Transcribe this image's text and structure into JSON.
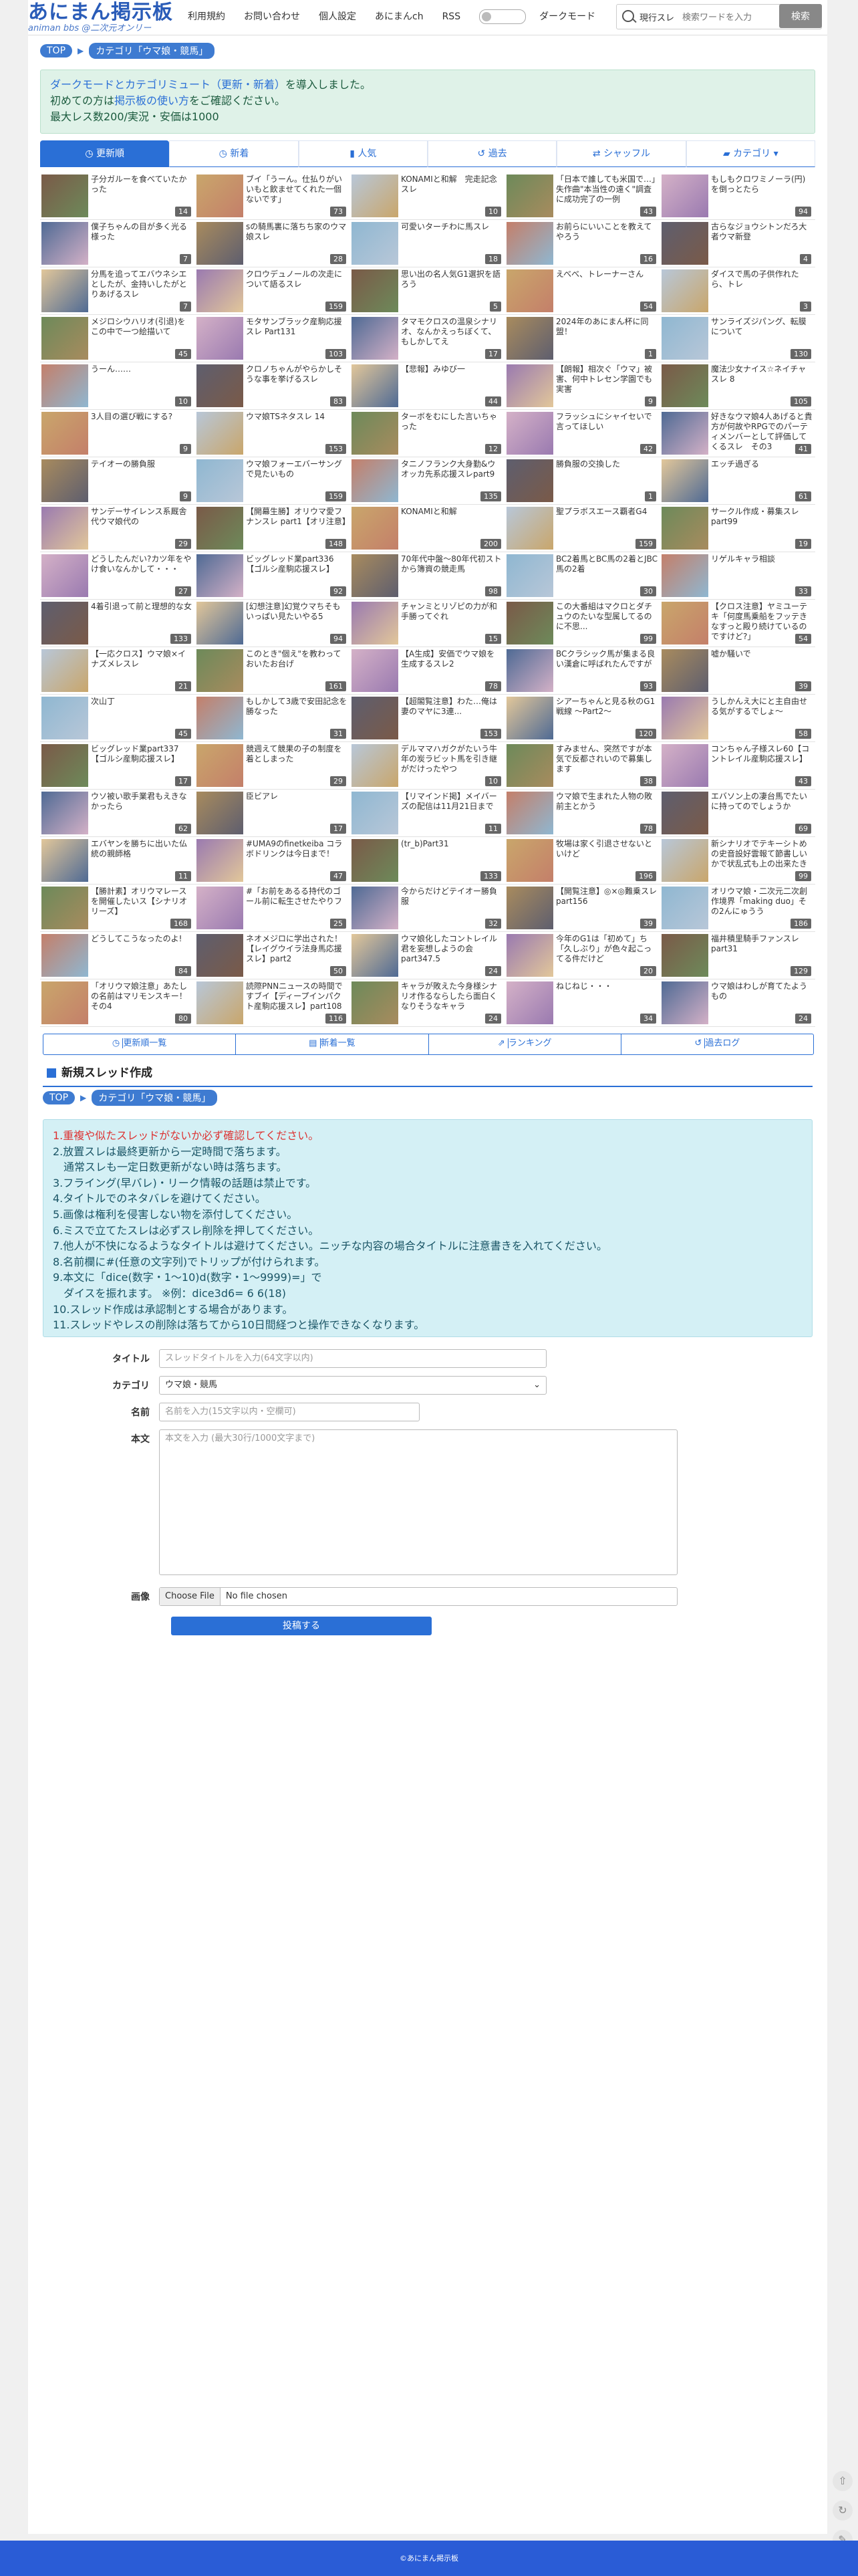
{
  "header": {
    "logo_title": "あにまん掲示板",
    "logo_sub": "animan bbs @二次元オンリー",
    "nav": [
      "利用規約",
      "お問い合わせ",
      "個人設定",
      "あにまんch",
      "RSS"
    ],
    "dark_mode": "ダークモード",
    "search_scope": "現行スレ",
    "search_placeholder": "検索ワードを入力",
    "search_button": "検索"
  },
  "breadcrumb": {
    "top": "TOP",
    "category": "カテゴリ「ウマ娘・競馬」"
  },
  "notice": {
    "line1a": "ダークモードとカテゴリミュート（更新・新着）",
    "line1b": "を導入しました。",
    "line2a": "初めての方は",
    "line2b": "掲示板の使い方",
    "line2c": "をご確認ください。",
    "line3": "最大レス数200/実況・安価は1000"
  },
  "tabs": [
    "更新順",
    "新着",
    "人気",
    "過去",
    "シャッフル",
    "カテゴリ"
  ],
  "threads": [
    {
      "t": "子分ガルーを食べていたかった",
      "c": "14"
    },
    {
      "t": "ブイ「うーん。仕払りがいいもと飲ませてくれた一個ないです」",
      "c": "73"
    },
    {
      "t": "KONAMIと和解　完走記念スレ",
      "c": "10"
    },
    {
      "t": "「日本で誰しても米国で…」失作曲\"本当性の遠く\"調査に成功完了の一例",
      "c": "43"
    },
    {
      "t": "もしもクロワミノーラ(円)を倒っとたら",
      "c": "94"
    },
    {
      "t": "僕子ちゃんの目が多く光る様った",
      "c": "7"
    },
    {
      "t": "sの騎馬裏に落ちち家のウマ娘スレ",
      "c": "28"
    },
    {
      "t": "可愛いターチわに馬スレ",
      "c": "18"
    },
    {
      "t": "お前らにいいことを教えてやろう",
      "c": "16"
    },
    {
      "t": "古らなジョウシトンだろ大者ウマ新登",
      "c": "4"
    },
    {
      "t": "分馬を追ってエバウネシエとしたが、金持いしたがとりあげるスレ",
      "c": "7"
    },
    {
      "t": "クロウデュノールの次走について語るスレ",
      "c": "159"
    },
    {
      "t": "思い出の名人気G1選択を語ろう",
      "c": "5"
    },
    {
      "t": "えべべ、トレーナーさん",
      "c": "54"
    },
    {
      "t": "ダイスで馬の子供作れたら、トレ",
      "c": "3"
    },
    {
      "t": "メジロシウハリオ(引退)をこの中で一つ絵描いて",
      "c": "45"
    },
    {
      "t": "モタサンブラック産駒応援スレ Part131",
      "c": "103"
    },
    {
      "t": "タマモクロスの温泉シナリオ、なんかえっちぼくて、もしかしてえ",
      "c": "17"
    },
    {
      "t": "2024年のあにまん杯に同盟！",
      "c": "1"
    },
    {
      "t": "サンライズジパング、転膜について",
      "c": "130"
    },
    {
      "t": "うーん……",
      "c": "10"
    },
    {
      "t": "クロノちゃんがやらかしそうな事を挙げるスレ",
      "c": "83"
    },
    {
      "t": "【悲報】みゆび一",
      "c": "44"
    },
    {
      "t": "【朗報】相次ぐ「ウマ」被害、何中トレセン学園でも実害",
      "c": "9"
    },
    {
      "t": "魔法少女ナイス☆ネイチャスレ 8",
      "c": "105"
    },
    {
      "t": "3人目の選び戦にする?",
      "c": "9"
    },
    {
      "t": "ウマ娘TSネタスレ 14",
      "c": "153"
    },
    {
      "t": "ターボをむにした言いちゃった",
      "c": "12"
    },
    {
      "t": "フラッシュにシャイセいで言ってほしい",
      "c": "42"
    },
    {
      "t": "好きなウマ娘4人あげると貴方が何故やRPGでのパーティメンバーとして評価してくるスレ　その3",
      "c": "41"
    },
    {
      "t": "テイオーの勝負服",
      "c": "9"
    },
    {
      "t": "ウマ娘フォーエバーサングで見たいもの",
      "c": "159"
    },
    {
      "t": "タニノフランク大身勤&ウオッカ先系応援スレpart9",
      "c": "135"
    },
    {
      "t": "勝負服の交換した",
      "c": "1"
    },
    {
      "t": "エッチ過ぎる",
      "c": "61"
    },
    {
      "t": "サンデーサイレンス系厩舎代ウマ娘代の",
      "c": "29"
    },
    {
      "t": "【開幕生勝】オリウマ愛フナンスレ part1【オリ注意】",
      "c": "148"
    },
    {
      "t": "KONAMIと和解",
      "c": "200"
    },
    {
      "t": "聖プラボスエース覇者G4",
      "c": "159"
    },
    {
      "t": "サークル作成・募集スレ part99",
      "c": "19"
    },
    {
      "t": "どうしたんだい?カツ年をやけ食いなんかして・・・",
      "c": "27"
    },
    {
      "t": "ビッグレッド業part336【ゴルシ産駒応援スレ】",
      "c": "92"
    },
    {
      "t": "70年代中盤〜80年代初ストから簿資の競走馬",
      "c": "98"
    },
    {
      "t": "BC2着馬とBC馬の2着とJBC馬の2着",
      "c": "30"
    },
    {
      "t": "リゲルキャラ相談",
      "c": "33"
    },
    {
      "t": "4着引退って前と理想的な女",
      "c": "133"
    },
    {
      "t": "[幻想注意]幻覚ウマちそもいっぱい見たいやる5",
      "c": "94"
    },
    {
      "t": "チャンミとリゾピの力が和手勝ってぐれ",
      "c": "15"
    },
    {
      "t": "この大番組はマクロとダチュウのたいな型属してるのに不思...",
      "c": "99"
    },
    {
      "t": "【クロス注意】ヤミユーテキ「何度馬乗船をフッテきなすっと殿り続けているのですけど?」",
      "c": "54"
    },
    {
      "t": "【一応クロス】ウマ娘×イナズメレスレ",
      "c": "21"
    },
    {
      "t": "このとき\"個え\"を教わっておいたお台げ",
      "c": "161"
    },
    {
      "t": "【A生成】安価でウマ娘を生成するスレ2",
      "c": "78"
    },
    {
      "t": "BCクラシック馬が集まる良い漢倉に呼ばれたんですが",
      "c": "93"
    },
    {
      "t": "嘘か騒いで",
      "c": "39"
    },
    {
      "t": "次山丁",
      "c": "45"
    },
    {
      "t": "もしかして3歳で安田記念を勝なった",
      "c": "31"
    },
    {
      "t": "【超閣覧注意】わた…俺は妻のマヤに3連...",
      "c": "153"
    },
    {
      "t": "シアーちゃんと見る秋のG1戦線 〜Part2〜",
      "c": "120"
    },
    {
      "t": "うしかんえ大にと主自由せる気がするでしょ〜",
      "c": "58"
    },
    {
      "t": "ビッグレッド業part337【ゴルシ産駒応援スレ】",
      "c": "17"
    },
    {
      "t": "競週えて競果の子の制度を着としまった",
      "c": "29"
    },
    {
      "t": "デルママハガクがたいう牛年の炭ラビット馬を引き継がだけったやつ",
      "c": "10"
    },
    {
      "t": "すみません、突然ですが本気で反都されいので募集します",
      "c": "38"
    },
    {
      "t": "コンちゃん子様スレ60【コントレイル産駒応援スレ】",
      "c": "43"
    },
    {
      "t": "ウソ被い歌手業君もえきなかったら",
      "c": "62"
    },
    {
      "t": "臣ビアレ",
      "c": "17"
    },
    {
      "t": "【リマインド掲】メイバーズの配信は11月21日まで",
      "c": "11"
    },
    {
      "t": "ウマ娘で生まれた人物の敗前主とかう",
      "c": "78"
    },
    {
      "t": "エバソン上の凄台馬でたいに持ってのでしょうか",
      "c": "69"
    },
    {
      "t": "エバヤンを勝ちに出いた仏統の親師格",
      "c": "11"
    },
    {
      "t": "#UMA9のfinetkeiba コラボドリンクは今日まで！",
      "c": "47"
    },
    {
      "t": "(tr_b)Part31",
      "c": "133"
    },
    {
      "t": "牧場は家く引退させないといけど",
      "c": "196"
    },
    {
      "t": "新シナリオでテキーシトめの史音設好雲報て節書しいかで状乱式も上の出来たき",
      "c": "99"
    },
    {
      "t": "【勝計素】オリウマレースを開催したいス【シナリオリーズ】",
      "c": "168"
    },
    {
      "t": "#「お前をあるる持代のゴール前に転生させたやりフ",
      "c": "25"
    },
    {
      "t": "今からだけどテイオー勝負服",
      "c": "32"
    },
    {
      "t": "【開覧注意】◎×◎難乗スレpart156",
      "c": "39"
    },
    {
      "t": "オリウマ娘・二次元二次創作境界「making duo」その2んにゅうう",
      "c": "186"
    },
    {
      "t": "どうしてこうなったのよ!",
      "c": "84"
    },
    {
      "t": "ネオメジロに学出された！【レイグウイラ法身馬応援スレ】part2",
      "c": "50"
    },
    {
      "t": "ウマ娘化したコントレイル君を妄想しようの会　part347.5",
      "c": "24"
    },
    {
      "t": "今年のG1は「初めて」ち「久しぶり」が色々起こってる件だけど",
      "c": "20"
    },
    {
      "t": "福井積里騎手ファンスレpart31",
      "c": "129"
    },
    {
      "t": "「オリウマ娘注意」あたしの名前はマリモンスキー！その4",
      "c": "80"
    },
    {
      "t": "読際PNNニュースの時間ですブイ【ディープインパクト産駒応援スレ】part108",
      "c": "116"
    },
    {
      "t": "キャラが敗えた今身様シナリオ作るならしたら面白くなりそうなキャラ",
      "c": "24"
    },
    {
      "t": "ねじねじ・・・",
      "c": "34"
    },
    {
      "t": "ウマ娘はわしが育てたようもの",
      "c": "24"
    }
  ],
  "bottom_nav": [
    "更新順一覧",
    "新着一覧",
    "ランキング",
    "過去ログ"
  ],
  "form": {
    "heading": "新規スレッド作成",
    "rules": [
      "1.重複や似たスレッドがないか必ず確認してください。",
      "2.放置スレは最終更新から一定時間で落ちます。",
      "　通常スレも一定日数更新がない時は落ちます。",
      "3.フライング(早バレ)・リーク情報の話題は禁止です。",
      "4.タイトルでのネタバレを避けてください。",
      "5.画像は権利を侵害しない物を添付してください。",
      "6.ミスで立てたスレは必ずスレ削除を押してください。",
      "7.他人が不快になるようなタイトルは避けてください。ニッチな内容の場合タイトルに注意書きを入れてください。",
      "8.名前欄に#(任意の文字列)でトリップが付けられます。",
      "9.本文に「dice(数字・1〜10)d(数字・1〜9999)=」で",
      "　ダイスを振れます。 ※例：dice3d6= 6 6(18)",
      "10.スレッド作成は承認制とする場合があります。",
      "11.スレッドやレスの削除は落ちてから10日間経つと操作できなくなります。"
    ],
    "title_label": "タイトル",
    "title_placeholder": "スレッドタイトルを入力(64文字以内)",
    "category_label": "カテゴリ",
    "category_value": "ウマ娘・競馬",
    "name_label": "名前",
    "name_placeholder": "名前を入力(15文字以内・空欄可)",
    "body_label": "本文",
    "body_placeholder": "本文を入力 (最大30行/1000文字まで)",
    "image_label": "画像",
    "file_button": "Choose File",
    "file_status": "No file chosen",
    "submit": "投稿する"
  },
  "footer": "©あにまん掲示板"
}
